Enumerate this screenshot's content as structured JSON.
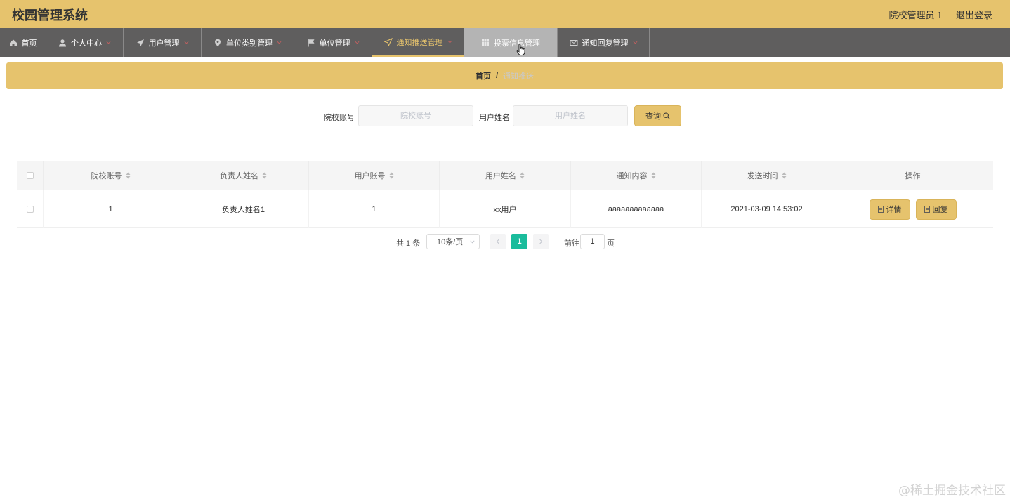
{
  "app": {
    "title": "校园管理系统"
  },
  "user": {
    "name": "院校管理员 1",
    "logout": "退出登录"
  },
  "nav": {
    "items": [
      {
        "label": "首页",
        "icon": "home-icon",
        "has_caret": false
      },
      {
        "label": "个人中心",
        "icon": "user-icon",
        "has_caret": true
      },
      {
        "label": "用户管理",
        "icon": "send-icon",
        "has_caret": true
      },
      {
        "label": "单位类别管理",
        "icon": "location-icon",
        "has_caret": true
      },
      {
        "label": "单位管理",
        "icon": "flag-icon",
        "has_caret": true
      },
      {
        "label": "通知推送管理",
        "icon": "send-icon",
        "has_caret": true,
        "state": "active"
      },
      {
        "label": "投票信息管理",
        "icon": "grid-icon",
        "has_caret": false,
        "state": "hover"
      },
      {
        "label": "通知回复管理",
        "icon": "mail-icon",
        "has_caret": true
      }
    ]
  },
  "breadcrumb": {
    "home": "首页",
    "separator": "/",
    "current": "通知推送"
  },
  "search": {
    "school_label": "院校账号",
    "school_placeholder": "院校账号",
    "username_label": "用户姓名",
    "username_placeholder": "用户姓名",
    "query_label": "查询"
  },
  "table": {
    "columns": [
      "院校账号",
      "负责人姓名",
      "用户账号",
      "用户姓名",
      "通知内容",
      "发送时间",
      "操作"
    ],
    "rows": [
      {
        "school_account": "1",
        "leader_name": "负责人姓名1",
        "user_account": "1",
        "user_name": "xx用户",
        "content": "aaaaaaaaaaaaa",
        "send_time": "2021-03-09 14:53:02"
      }
    ],
    "actions": {
      "detail": "详情",
      "reply": "回复"
    }
  },
  "pagination": {
    "total_text": "共 1 条",
    "page_size": "10条/页",
    "current_page": "1",
    "goto_label": "前往",
    "goto_value": "1",
    "page_suffix": "页"
  },
  "watermark": "@稀土掘金技术社区",
  "colors": {
    "accent": "#e6c36d",
    "nav_bg": "#5f5e5e",
    "page_active": "#1abc9c"
  }
}
